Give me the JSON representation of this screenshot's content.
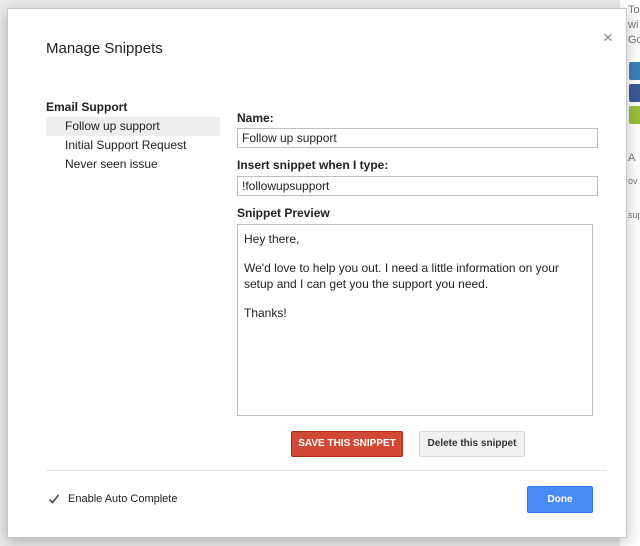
{
  "background": {
    "snippets": [
      "To",
      "wi",
      "Go",
      "A",
      "ov",
      "supp"
    ]
  },
  "dialog": {
    "title": "Manage Snippets",
    "close_symbol": "×"
  },
  "sidebar": {
    "group_label": "Email Support",
    "items": [
      {
        "label": "Follow up support",
        "selected": true
      },
      {
        "label": "Initial Support Request",
        "selected": false
      },
      {
        "label": "Never seen issue",
        "selected": false
      }
    ]
  },
  "form": {
    "name_label": "Name:",
    "name_value": "Follow up support",
    "trigger_label": "Insert snippet when I type:",
    "trigger_value": "!followupsupport",
    "preview_label": "Snippet Preview",
    "preview_paragraphs": [
      "Hey there,",
      "We'd love to help you out. I need a little information on your setup and I can get you the support you need.",
      "Thanks!"
    ]
  },
  "actions": {
    "save_label": "SAVE THIS SNIPPET",
    "delete_label": "Delete this snippet",
    "done_label": "Done"
  },
  "footer": {
    "auto_complete_label": "Enable Auto Complete",
    "auto_complete_checked": true
  },
  "colors": {
    "save_button": "#d14836",
    "done_button": "#4a8af4",
    "selected_item_bg": "#eeeeee"
  }
}
